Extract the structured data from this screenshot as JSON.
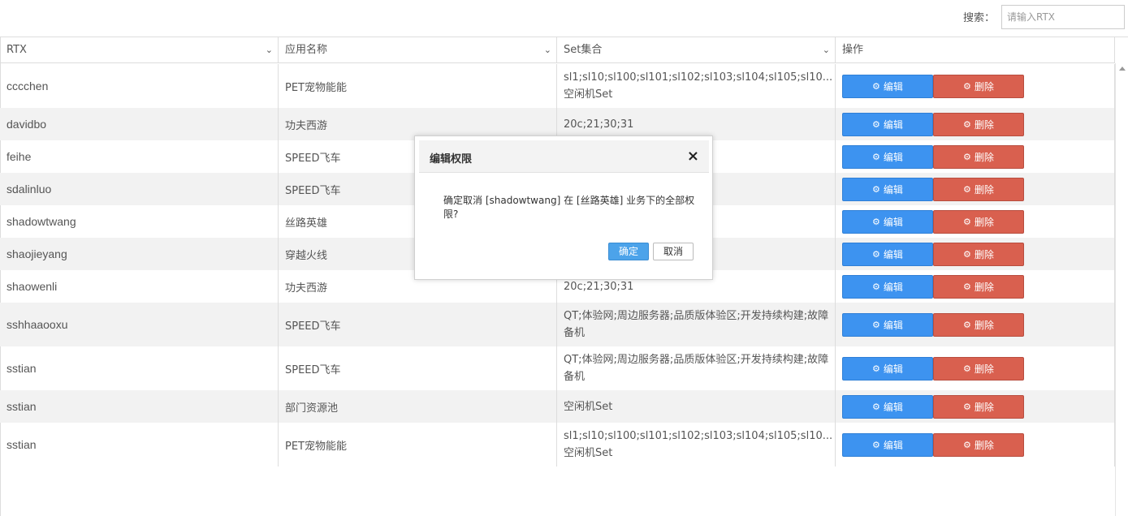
{
  "search": {
    "label": "搜索：",
    "placeholder": "请输入RTX"
  },
  "table": {
    "columns": [
      {
        "label": "RTX",
        "sortable": true
      },
      {
        "label": "应用名称",
        "sortable": true
      },
      {
        "label": "Set集合",
        "sortable": true
      },
      {
        "label": "操作",
        "sortable": false
      }
    ],
    "rows": [
      {
        "rtx": "cccchen",
        "app": "PET宠物能能",
        "set": "sl1;sl10;sl100;sl101;sl102;sl103;sl104;sl105;sl10... 空闲机Set",
        "edit": "编辑",
        "delete": "删除"
      },
      {
        "rtx": "davidbo",
        "app": "功夫西游",
        "set": "20c;21;30;31",
        "edit": "编辑",
        "delete": "删除"
      },
      {
        "rtx": "feihe",
        "app": "SPEED飞车",
        "set": "",
        "edit": "编辑",
        "delete": "删除"
      },
      {
        "rtx": "sdalinluo",
        "app": "SPEED飞车",
        "set": "",
        "edit": "编辑",
        "delete": "删除"
      },
      {
        "rtx": "shadowtwang",
        "app": "丝路英雄",
        "set": "",
        "edit": "编辑",
        "delete": "删除"
      },
      {
        "rtx": "shaojieyang",
        "app": "穿越火线",
        "set": "",
        "edit": "编辑",
        "delete": "删除"
      },
      {
        "rtx": "shaowenli",
        "app": "功夫西游",
        "set": "20c;21;30;31",
        "edit": "编辑",
        "delete": "删除"
      },
      {
        "rtx": "sshhaaooxu",
        "app": "SPEED飞车",
        "set": "QT;体验网;周边服务器;品质版体验区;开发持续构建;故障备机",
        "edit": "编辑",
        "delete": "删除"
      },
      {
        "rtx": "sstian",
        "app": "SPEED飞车",
        "set": "QT;体验网;周边服务器;品质版体验区;开发持续构建;故障备机",
        "edit": "编辑",
        "delete": "删除"
      },
      {
        "rtx": "sstian",
        "app": "部门资源池",
        "set": "空闲机Set",
        "edit": "编辑",
        "delete": "删除"
      },
      {
        "rtx": "sstian",
        "app": "PET宠物能能",
        "set": "sl1;sl10;sl100;sl101;sl102;sl103;sl104;sl105;sl10... 空闲机Set",
        "edit": "编辑",
        "delete": "删除"
      }
    ]
  },
  "modal": {
    "title": "编辑权限",
    "close": "×",
    "message": "确定取消 [shadowtwang] 在 [丝路英雄] 业务下的全部权限?",
    "ok_label": "确定",
    "cancel_label": "取消"
  },
  "icons": {
    "edit": "gear-icon",
    "delete": "gear-icon",
    "sort": "chevron-down-icon",
    "close": "close-icon"
  },
  "colors": {
    "edit_button": "#3d93f0",
    "delete_button": "#d9604f",
    "ok_button": "#4ca3ea"
  }
}
